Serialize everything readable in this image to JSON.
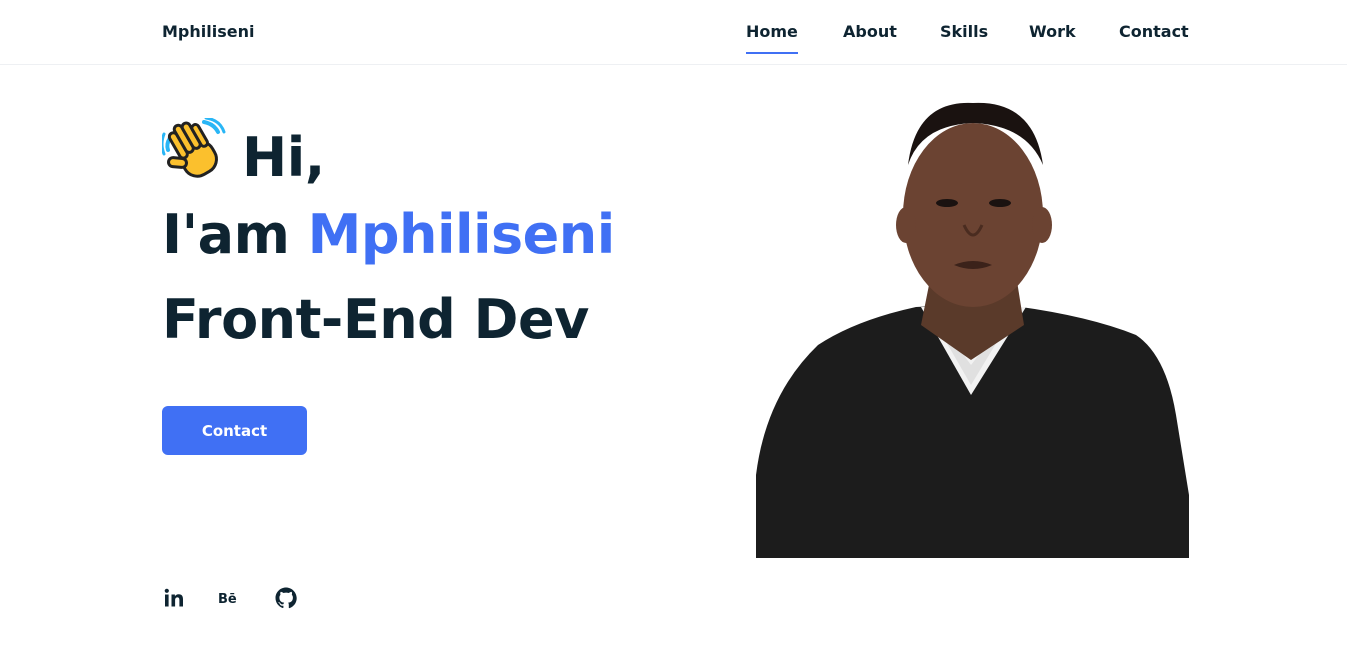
{
  "header": {
    "logo": "Mphiliseni",
    "nav": [
      {
        "label": "Home",
        "active": true
      },
      {
        "label": "About",
        "active": false
      },
      {
        "label": "Skills",
        "active": false
      },
      {
        "label": "Work",
        "active": false
      },
      {
        "label": "Contact",
        "active": false
      }
    ]
  },
  "hero": {
    "greeting": "Hi,",
    "greeting_icon": "waving-hand-icon",
    "intro_prefix": "I'am",
    "name": "Mphiliseni",
    "role": "Front-End Dev",
    "cta_label": "Contact",
    "photo_alt": "portrait photo"
  },
  "socials": [
    {
      "icon": "linkedin-icon"
    },
    {
      "icon": "behance-icon"
    },
    {
      "icon": "github-icon"
    }
  ],
  "colors": {
    "accent": "#4070f4",
    "text": "#0e2431",
    "background": "#ffffff"
  }
}
